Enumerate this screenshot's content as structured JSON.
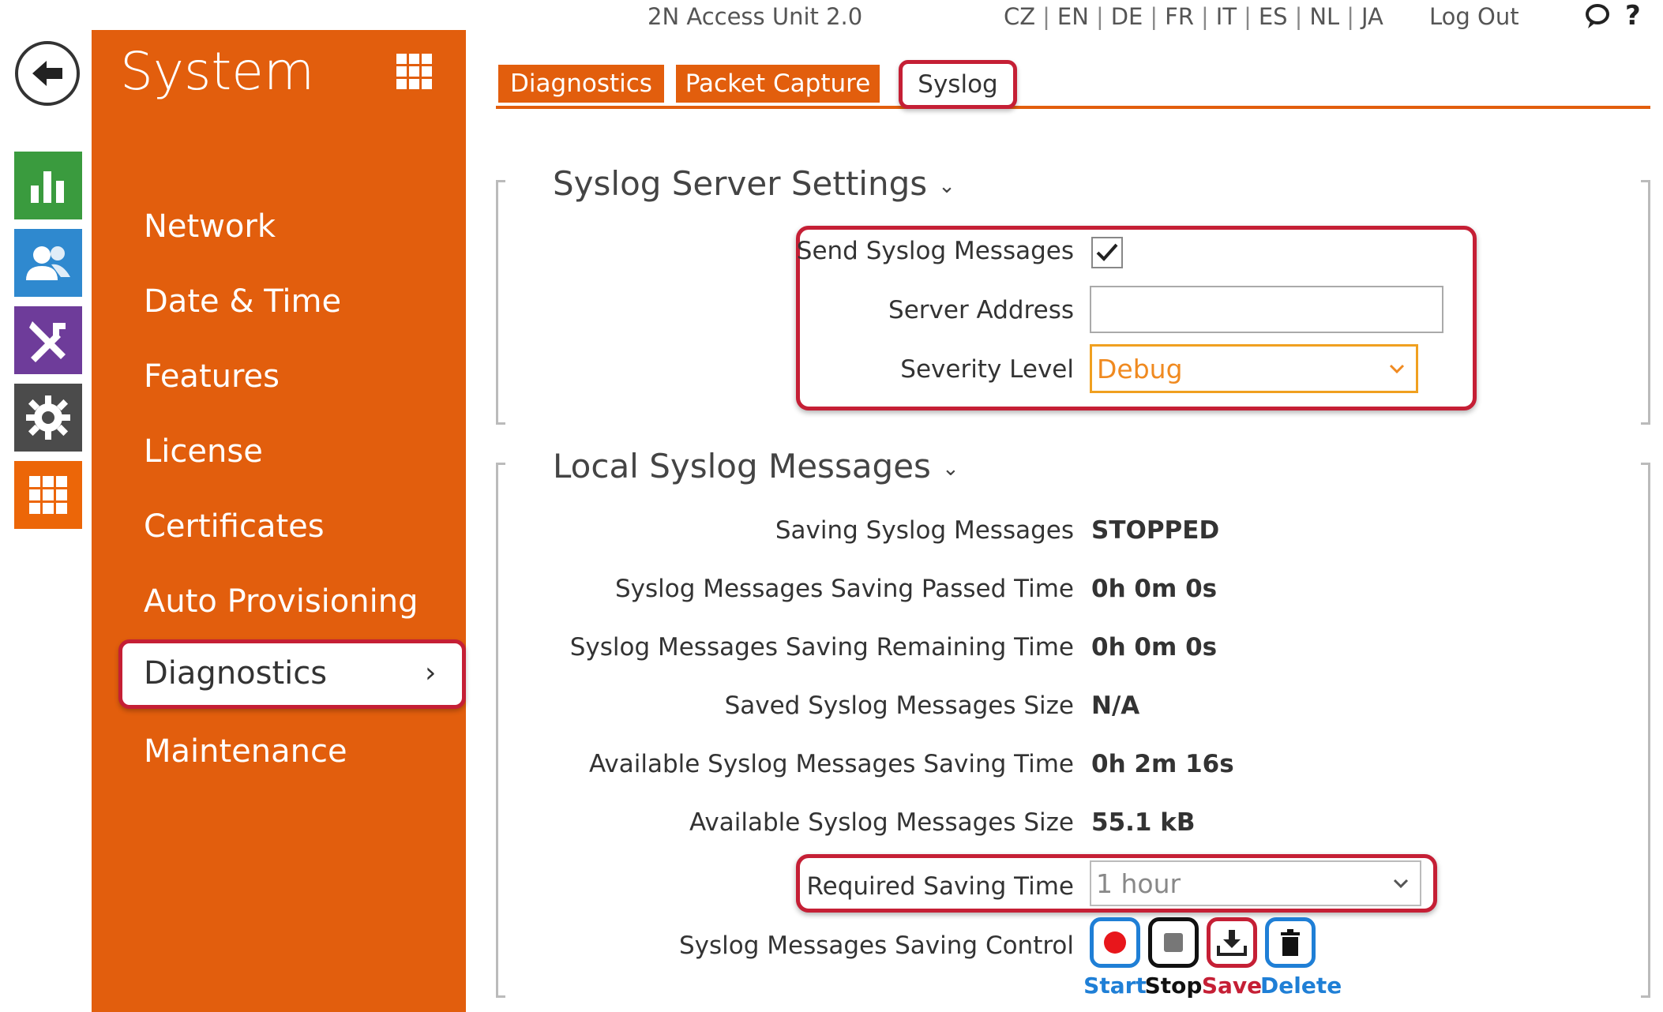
{
  "header": {
    "device_title": "2N Access Unit 2.0",
    "languages": [
      "CZ",
      "EN",
      "DE",
      "FR",
      "IT",
      "ES",
      "NL",
      "JA"
    ],
    "logout_label": "Log Out",
    "help_label": "?"
  },
  "sidebar": {
    "title": "System",
    "items": [
      {
        "label": "Network"
      },
      {
        "label": "Date & Time"
      },
      {
        "label": "Features"
      },
      {
        "label": "License"
      },
      {
        "label": "Certificates"
      },
      {
        "label": "Auto Provisioning"
      },
      {
        "label": "Diagnostics",
        "active": true
      },
      {
        "label": "Maintenance"
      }
    ],
    "active_chevron": "›"
  },
  "tabs": [
    {
      "label": "Diagnostics"
    },
    {
      "label": "Packet Capture"
    },
    {
      "label": "Syslog",
      "active": true
    }
  ],
  "syslog_server": {
    "title": "Syslog Server Settings",
    "send_label": "Send Syslog Messages",
    "send_checked": true,
    "server_address_label": "Server Address",
    "server_address_value": "",
    "severity_label": "Severity Level",
    "severity_value": "Debug"
  },
  "local_syslog": {
    "title": "Local Syslog Messages",
    "rows": [
      {
        "label": "Saving Syslog Messages",
        "value": "STOPPED"
      },
      {
        "label": "Syslog Messages Saving Passed Time",
        "value": "0h 0m 0s"
      },
      {
        "label": "Syslog Messages Saving Remaining Time",
        "value": "0h 0m 0s"
      },
      {
        "label": "Saved Syslog Messages Size",
        "value": "N/A"
      },
      {
        "label": "Available Syslog Messages Saving Time",
        "value": "0h 2m 16s"
      },
      {
        "label": "Available Syslog Messages Size",
        "value": "55.1 kB"
      }
    ],
    "required_time_label": "Required Saving Time",
    "required_time_value": "1 hour",
    "control_label": "Syslog Messages Saving Control",
    "controls": {
      "start": "Start",
      "stop": "Stop",
      "save": "Save",
      "delete": "Delete"
    }
  },
  "colors": {
    "brand_orange": "#e25e0d",
    "highlight_red": "#c51f35",
    "start_blue": "#1f7fd6",
    "select_orange": "#f0a020"
  }
}
